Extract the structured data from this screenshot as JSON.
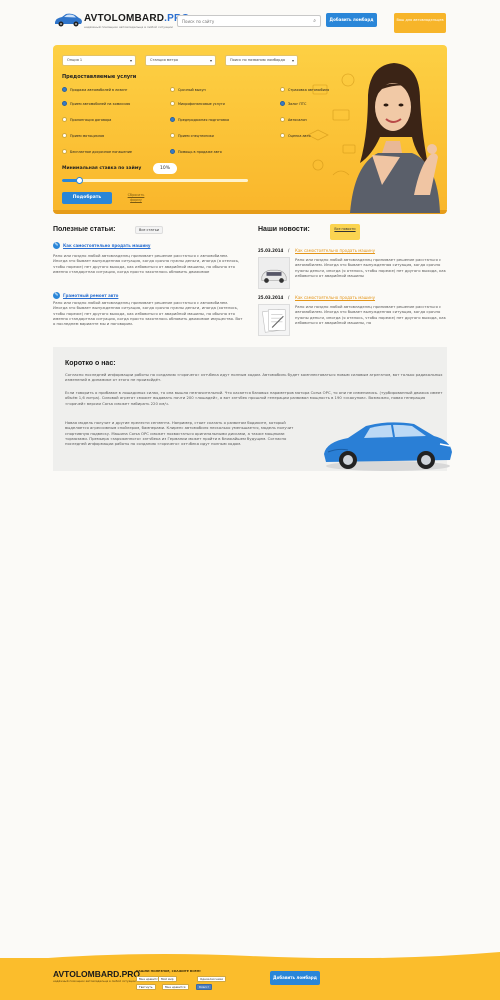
{
  "header": {
    "logo_title_a": "AVTOLOMBARD",
    "logo_title_b": ".PRO",
    "logo_sub": "надёжный помощник автовладельца в любой ситуации",
    "search_placeholder": "Поиск по сайту",
    "add_button": "Добавить ломбард",
    "request_button": "Ваш для автовладельцев"
  },
  "filters": {
    "option_1": "Опция 1",
    "station": "Станция метро",
    "name_search": "Поиск по названию ломбарда"
  },
  "services": {
    "title": "Предоставляемые услуги",
    "items": [
      {
        "label": "Продажа автомобилей в лизинг",
        "checked": true
      },
      {
        "label": "Срочный выкуп",
        "checked": false
      },
      {
        "label": "Страховка автомобиля",
        "checked": false
      },
      {
        "label": "Прием автомобилей на комиссию",
        "checked": true
      },
      {
        "label": "Микрофинансовые услуги",
        "checked": false
      },
      {
        "label": "Залог ПТС",
        "checked": true
      },
      {
        "label": "Пролонгация договора",
        "checked": false
      },
      {
        "label": "Предпродажная подготовка",
        "checked": true
      },
      {
        "label": "Автосалон",
        "checked": false
      },
      {
        "label": "Прием мотоциклов",
        "checked": false
      },
      {
        "label": "Прием спецтехники",
        "checked": false
      },
      {
        "label": "Оценка авто",
        "checked": false
      },
      {
        "label": "Бесплатное досрочное погашение",
        "checked": false
      },
      {
        "label": "Помощь в продаже авто",
        "checked": true
      }
    ]
  },
  "rate": {
    "title": "Минимальная ставка по займу",
    "value": "10%",
    "slider_level": 0.09
  },
  "actions": {
    "pick_button": "Подобрать",
    "reset_link": "Сбросить форму"
  },
  "articles": {
    "title": "Полезные статьи:",
    "all_button": "Все статьи",
    "items": [
      {
        "link": "Как самостоятельно продать машину",
        "text": "Рано или поздно любой автовладелец принимает решение расстаться с автомобилем. Иногда это бывает вынужденная ситуация, когда срочно нужны деньги, иногда (я отелось, чтобы пореже) нет другого выхода, как избавиться от аварийной машины, но обычно это именно стандартная ситуация, когда просто захотелось обновить движимое"
      },
      {
        "link": "Грамотный ремонт авто",
        "text": "Рано или поздно любой автовладелец принимает решение расстаться с автомобилем. Иногда это бывает вынужденная ситуация, когда срочно нужны деньги, иногда (хотелось, чтобы пореже) нет другого выхода, как избавиться от аварийной машины, но обычно это именно стандартная ситуация, когда просто захотелось обновить движимое имущество. Вот о последнем варианте мы и поговорим."
      }
    ]
  },
  "news": {
    "title": "Наши новости:",
    "all_button": "Все новости",
    "items": [
      {
        "date": "25.03.2014",
        "sep": "/",
        "link": "Как самостоятельно продать машину",
        "text": "Рано или поздно любой автовладелец принимает решение расстаться с автомобилем. Иногда это бывает вынужденная ситуация, когда срочно нужны деньги, иногда (я отелось, чтобы пореже) нет другого выхода, как избавиться от аварийной машины"
      },
      {
        "date": "25.03.2014",
        "sep": "/",
        "link": "Как самостоятельно продать машину",
        "text": "Рано или поздно любой автовладелец принимает решение расстаться с автомобилем. Иногда это бывает вынужденная ситуация, когда срочно нужны деньги, иногда (я отелось, чтобы пореже) нет другого выхода, как избавиться от аварийной машины, но"
      }
    ]
  },
  "about": {
    "title": "Коротко о нас:",
    "p1": "Согласно последней информации работы по созданию «горячего» хэтчбека идут полным ходом. Автомобиль будет комплектоваться новым силовым агрегатом, вот только радикальных изменений в динамике от этого не произойдёт.",
    "p2": "Если говорить о прибавке в лошадиных силах, то она вышла незначительной. Что касается базовых параметров мотора Corsa OPC, то они не изменились. (турбированный движок имеет объём 1,6 литра). Силовой агрегат сможет выдавать почти 200 «лошадей», а вот хэтчбек прошлой генерации развивал мощность в 190 «скакунов». Возможно, новая генерация «горячей» версии Corsa сможет набирать 220 км/ч.",
    "p3": "Новая модель получит и другие прелести сегмента. Например, стоит сказать о развитом бодиките, который выделяется агрессивным спойлером, бамперами. Клиренс автомобиля несколько уменьшается, модель получит спортивную подвеску. Машина Corsa OPC сможет похвастаться оригинальными дисками, а также мощными тормозами. Премьера «заряженного» хэтчбека из Германии может пройти в ближайшем будущем. Согласно последней информации работы по созданию «горячего» хэтчбека идут полным ходом."
  },
  "footer": {
    "logo": "AVTOLOMBARD.PRO",
    "sub": "надёжный помощник автовладельца в любой ситуации",
    "share_title": "НАШЛИ ПОЛЕЗНОЕ, СКАЖИТЕ ВСЕМ!",
    "share_buttons": [
      "Мне нравится",
      "Мой мир",
      "Одноклассники",
      "Твитнуть",
      "Мне нравится",
      "Класс!"
    ],
    "add_button": "Добавить ломбард"
  },
  "colors": {
    "accent_blue": "#2a86d8",
    "accent_yellow": "#fbc135",
    "link_orange": "#e49518"
  }
}
